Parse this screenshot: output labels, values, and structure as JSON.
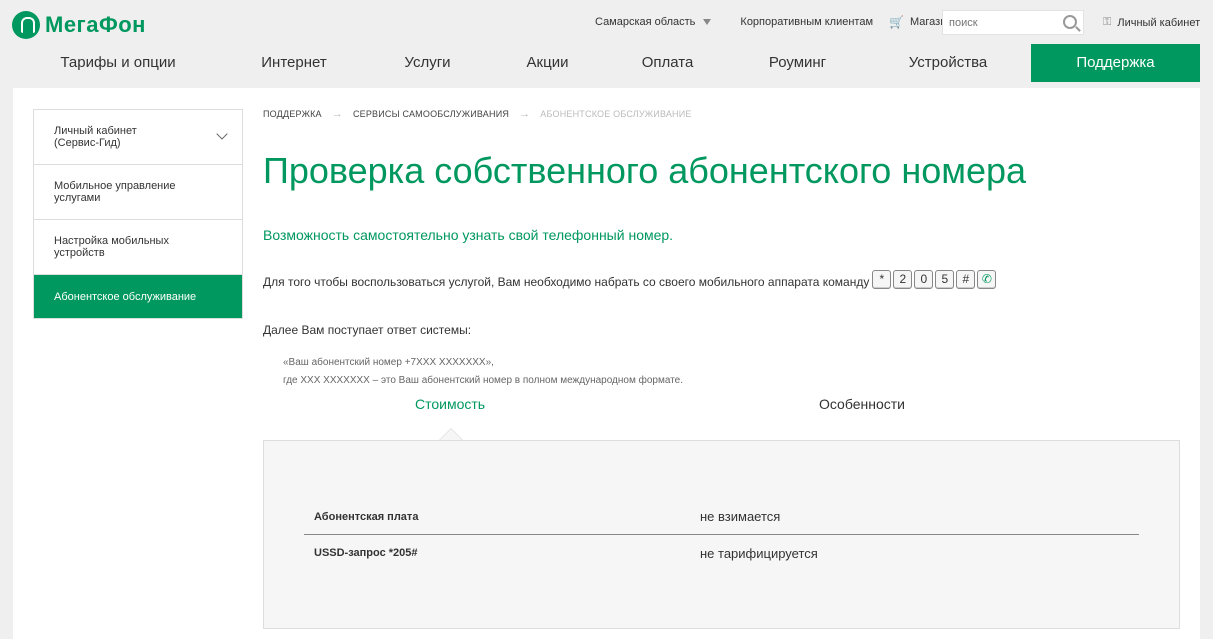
{
  "header": {
    "logo_text": "МегаФон",
    "region": "Самарская область",
    "corporate": "Корпоративным клиентам",
    "shop": "Магазин",
    "search_placeholder": "поиск",
    "cabinet": "Личный кабинет"
  },
  "nav": [
    {
      "label": "Тарифы и опции"
    },
    {
      "label": "Интернет"
    },
    {
      "label": "Услуги"
    },
    {
      "label": "Акции"
    },
    {
      "label": "Оплата"
    },
    {
      "label": "Роуминг"
    },
    {
      "label": "Устройства"
    },
    {
      "label": "Поддержка"
    }
  ],
  "sidebar": [
    {
      "label": "Личный кабинет (Сервис-Гид)"
    },
    {
      "label": "Мобильное управление услугами"
    },
    {
      "label": "Настройка мобильных устройств"
    },
    {
      "label": "Абонентское обслуживание"
    }
  ],
  "breadcrumb": [
    "ПОДДЕРЖКА",
    "СЕРВИСЫ САМООБСЛУЖИВАНИЯ",
    "АБОНЕНТСКОЕ ОБСЛУЖИВАНИЕ"
  ],
  "page": {
    "title": "Проверка собственного абонентского номера",
    "subtitle": "Возможность самостоятельно узнать свой телефонный номер.",
    "instruction": "Для того чтобы воспользоваться услугой, Вам необходимо набрать со своего мобильного аппарата команду",
    "keys": [
      "*",
      "2",
      "0",
      "5",
      "#",
      "✆"
    ],
    "reply_label": "Далее Вам поступает ответ системы:",
    "reply_line1": "«Ваш абонентский номер +7ХХХ ХХХХХХХ»,",
    "reply_line2": "где ХХХ ХХХХХХХ – это Ваш абонентский номер в полном международном формате."
  },
  "tabs": [
    {
      "label": "Стоимость"
    },
    {
      "label": "Особенности"
    }
  ],
  "prices": [
    {
      "name": "Абонентская плата",
      "value": "не взимается"
    },
    {
      "name": "USSD-запрос *205#",
      "value": "не тарифицируется"
    }
  ],
  "colors": {
    "brand_green": "#00985f"
  }
}
